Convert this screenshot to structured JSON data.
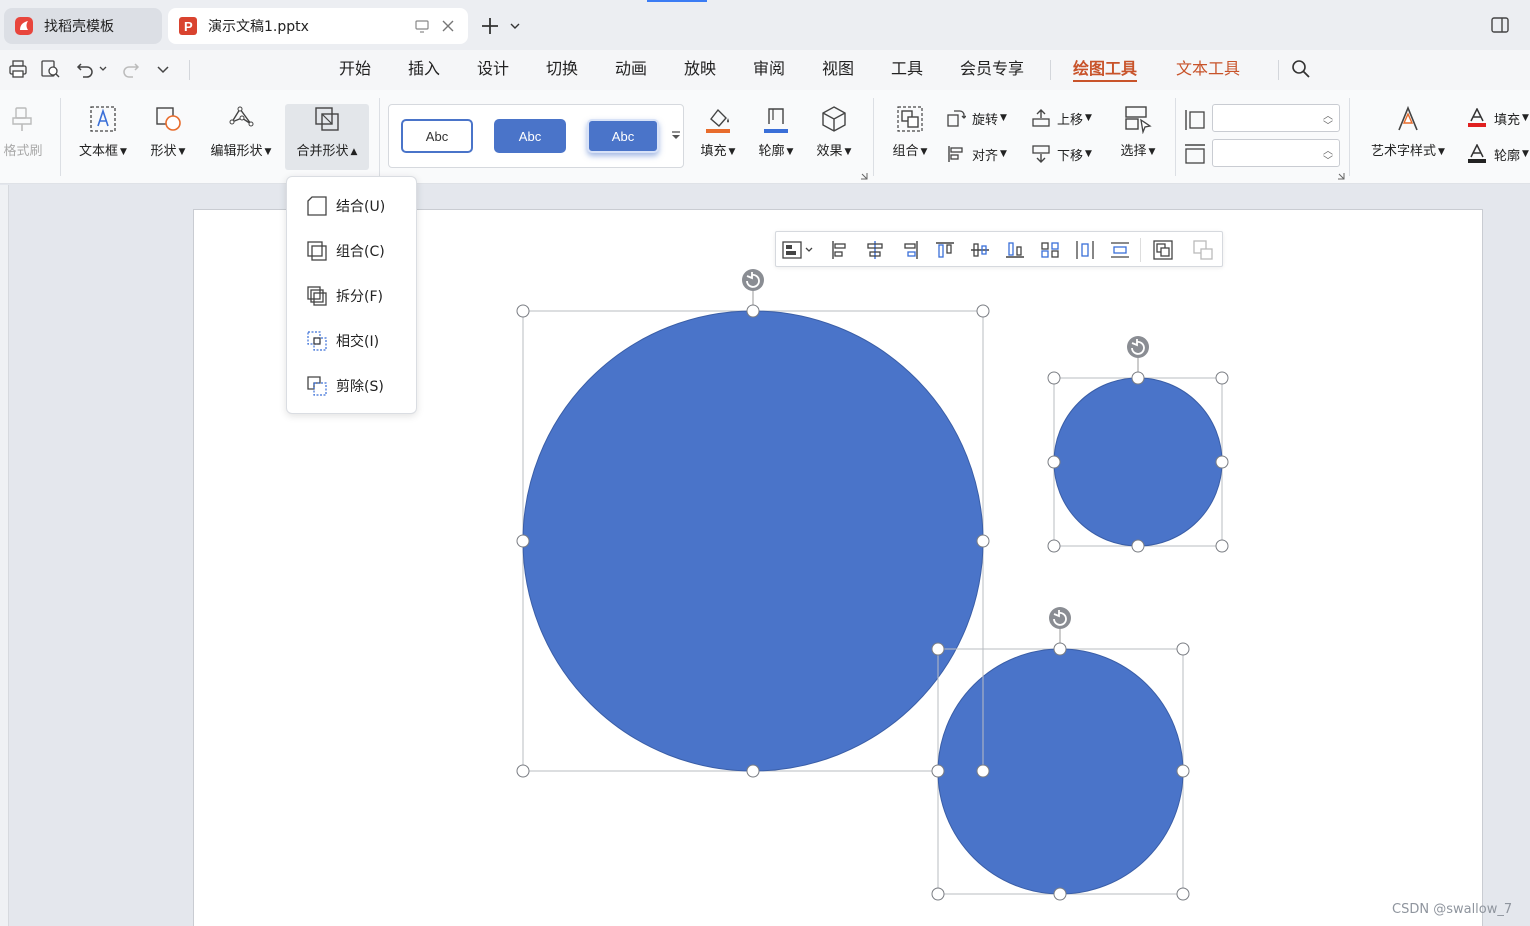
{
  "tabs": [
    {
      "label": "找稻壳模板"
    },
    {
      "label": "演示文稿1.pptx"
    }
  ],
  "menu": {
    "items": [
      "开始",
      "插入",
      "设计",
      "切换",
      "动画",
      "放映",
      "审阅",
      "视图",
      "工具",
      "会员专享",
      "绘图工具",
      "文本工具"
    ],
    "active": "绘图工具"
  },
  "ribbon": {
    "format_painter": "格式刷",
    "textbox": "文本框",
    "shape": "形状",
    "edit_shape": "编辑形状",
    "merge_shape": "合并形状",
    "style_presets": [
      "Abc",
      "Abc",
      "Abc"
    ],
    "fill": "填充",
    "outline": "轮廓",
    "effects": "效果",
    "group": "组合",
    "rotate": "旋转",
    "align": "对齐",
    "bring_forward": "上移",
    "send_backward": "下移",
    "select": "选择",
    "height_value": "",
    "width_value": "",
    "art_text_style": "艺术字样式",
    "text_fill": "填充",
    "text_outline": "轮廓"
  },
  "merge_menu": [
    {
      "label": "结合(U)",
      "icon": "union-icon"
    },
    {
      "label": "组合(C)",
      "icon": "combine-icon"
    },
    {
      "label": "拆分(F)",
      "icon": "fragment-icon"
    },
    {
      "label": "相交(I)",
      "icon": "intersect-icon"
    },
    {
      "label": "剪除(S)",
      "icon": "subtract-icon"
    }
  ],
  "colors": {
    "shape_fill": "#4a74c9",
    "accent_orange": "#c8532a",
    "fill_bar": "#e86c2c",
    "outline_bar": "#3a6fd8"
  },
  "watermark": "CSDN @swallow_7"
}
